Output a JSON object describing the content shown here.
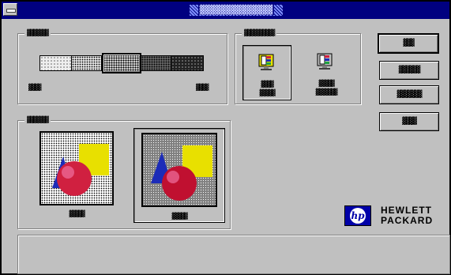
{
  "window": {
    "title": "▓▓▓▓▓▓▓▓▓▓▓▓▓▓"
  },
  "intensity_group": {
    "label": "▓▓▓▓▓▓▓",
    "left_caption": "▓▓▓▓",
    "right_caption": "▓▓▓▓",
    "level_percent": 50
  },
  "monitor_group": {
    "label": "▓▓▓▓▓▓▓▓▓▓",
    "options": [
      {
        "line1": "▓▓▓▓",
        "line2": "▓▓▓▓▓",
        "selected": true
      },
      {
        "line1": "▓▓▓▓▓",
        "line2": "▓▓▓▓▓▓▓",
        "selected": false
      }
    ]
  },
  "preview_group": {
    "label": "▓▓▓▓▓▓▓",
    "images": [
      {
        "caption": "▓▓▓▓▓",
        "selected": false
      },
      {
        "caption": "▓▓▓▓▓",
        "selected": true
      }
    ]
  },
  "buttons": {
    "ok": "▓▓▓",
    "cancel": "▓▓▓▓▓▓",
    "options": "▓▓▓▓▓▓▓",
    "help": "▓▓▓▓"
  },
  "brand": {
    "line1": "HEWLETT",
    "line2": "PACKARD",
    "logo": "hp"
  },
  "colors": {
    "titlebar": "#000080",
    "face": "#c0c0c0",
    "yellow": "#e8e000",
    "blue": "#1c2cb8",
    "red": "#d02040"
  }
}
